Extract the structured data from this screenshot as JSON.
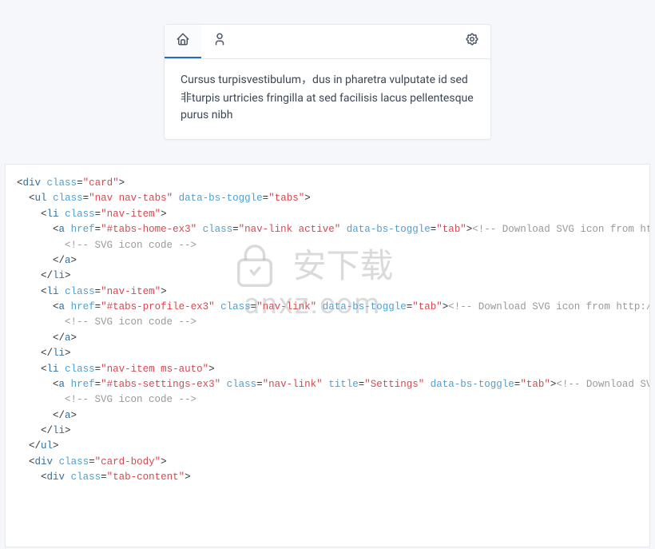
{
  "card": {
    "tabs": [
      {
        "name": "home",
        "active": true
      },
      {
        "name": "profile",
        "active": false
      },
      {
        "name": "settings",
        "active": false,
        "msAuto": true
      }
    ],
    "content_part1": "Cursus turpisvestibulum，dus in pharetra vulputate id sed ",
    "content_han": "非",
    "content_part2": "turpis urtricies fringilla at sed facilisis lacus pellentesque purus nibh"
  },
  "watermark": {
    "main": "安下载",
    "sub": "anxz.com"
  },
  "code_tokens": {
    "div": "div",
    "class": "class",
    "card": "\"card\"",
    "ul": "ul",
    "nav_nav_tabs": "\"nav nav-tabs\"",
    "data_bs_toggle": "data-bs-toggle",
    "tabs": "\"tabs\"",
    "li": "li",
    "nav_item": "\"nav-item\"",
    "a": "a",
    "href": "href",
    "tabs_home_ex3": "\"#tabs-home-ex3\"",
    "nav_link_active": "\"nav-link active\"",
    "tab": "\"tab\"",
    "comment_home": "<!-- Download SVG icon from http://tabler-icons.io/i/home -->",
    "comment_svg": "<!-- SVG icon code -->",
    "close_a": "a",
    "close_li": "li",
    "tabs_profile_ex3": "\"#tabs-profile-ex3\"",
    "nav_link": "\"nav-link\"",
    "comment_user": "<!-- Download SVG icon from http://tabler-icons.io/i/user -->",
    "nav_item_ms_auto": "\"nav-item ms-auto\"",
    "tabs_settings_ex3": "\"#tabs-settings-ex3\"",
    "title": "title",
    "settings": "\"Settings\"",
    "comment_settings": "<!-- Download SVG icon from http://tabler-icons.io/i/settings -->",
    "close_ul": "ul",
    "card_body": "\"card-body\"",
    "tab_content": "\"tab-content\""
  }
}
